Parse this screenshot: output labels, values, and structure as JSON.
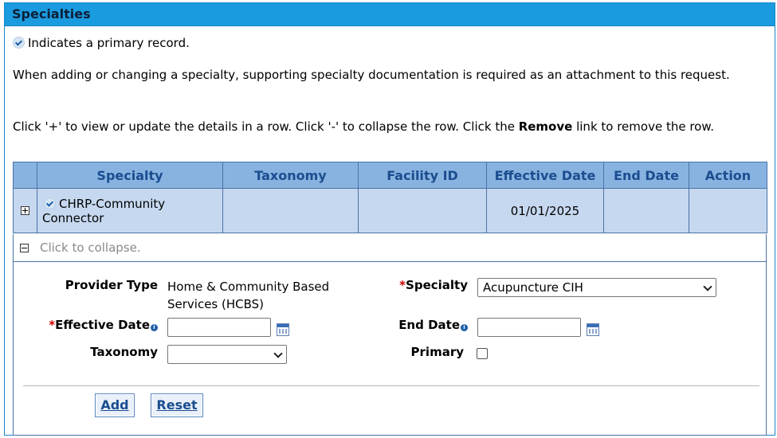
{
  "panel": {
    "title": "Specialties",
    "primary_note": "Indicates a primary record.",
    "doc_note": "When adding or changing a specialty, supporting specialty documentation is required as an attachment to this request.",
    "instructions_part1": "Click '+' to view or update the details in a row. Click '-' to collapse the row. Click the ",
    "instructions_bold": "Remove",
    "instructions_part2": " link to remove the row."
  },
  "table": {
    "columns": [
      "Specialty",
      "Taxonomy",
      "Facility ID",
      "Effective Date",
      "End Date",
      "Action"
    ],
    "rows": [
      {
        "specialty": "CHRP-Community Connector",
        "taxonomy": "",
        "facility_id": "",
        "effective_date": "01/01/2025",
        "end_date": "",
        "action": "",
        "primary": true
      }
    ],
    "collapse_text": "Click to collapse."
  },
  "form": {
    "provider_type_label": "Provider Type",
    "provider_type_value": "Home & Community Based Services (HCBS)",
    "specialty_label": "Specialty",
    "specialty_value": "Acupuncture CIH",
    "effective_date_label": "Effective Date",
    "effective_date_value": "",
    "end_date_label": "End Date",
    "end_date_value": "",
    "taxonomy_label": "Taxonomy",
    "taxonomy_value": "",
    "primary_label": "Primary",
    "required_mark": "*",
    "info_glyph": "i"
  },
  "buttons": {
    "add": "Add",
    "reset": "Reset"
  },
  "icons": {
    "primary": "primary-check-icon",
    "expand": "expand-plus-icon",
    "collapse": "collapse-minus-icon",
    "calendar": "calendar-icon",
    "info": "info-icon"
  },
  "colors": {
    "header_bg": "#1a9be0",
    "table_header_bg": "#88b3e0",
    "row_bg": "#c6d8ef",
    "required": "#cc0000"
  }
}
